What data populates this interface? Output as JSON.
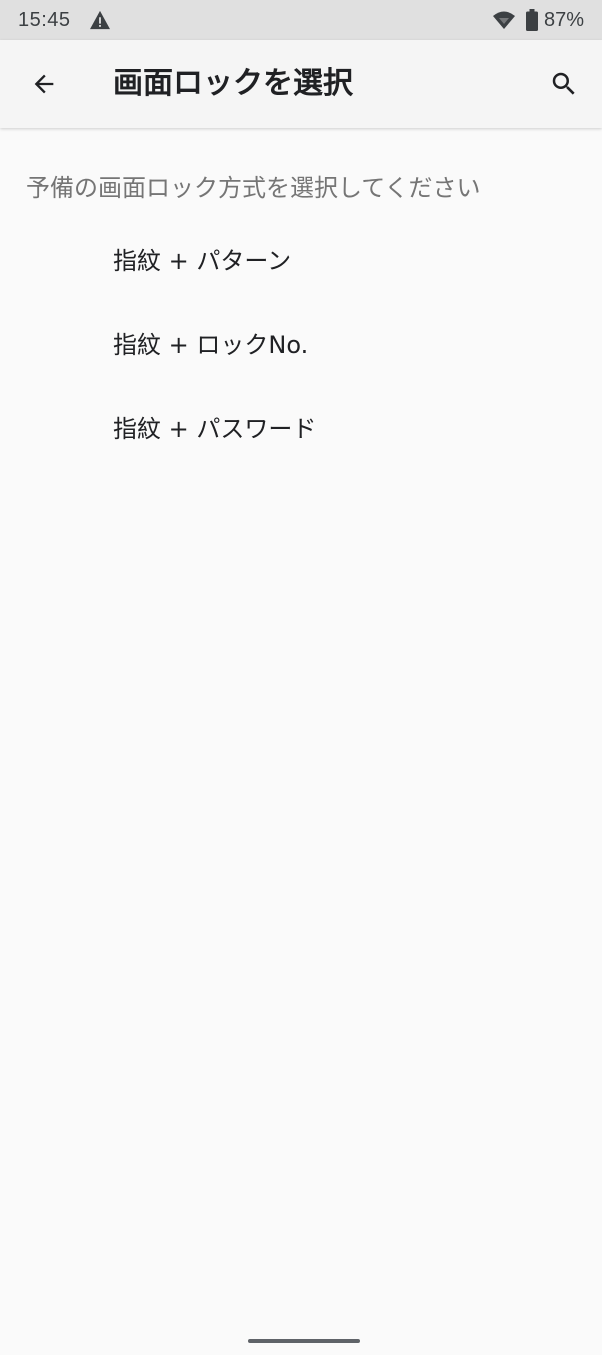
{
  "status_bar": {
    "time": "15:45",
    "battery": "87%",
    "icons": [
      "warning-icon",
      "wifi-icon",
      "battery-icon"
    ]
  },
  "app_bar": {
    "title": "画面ロックを選択",
    "back_icon": "arrow-back-icon",
    "search_icon": "search-icon"
  },
  "section": {
    "header": "予備の画面ロック方式を選択してください"
  },
  "options": [
    {
      "label": "指紋 + パターン"
    },
    {
      "label": "指紋 + ロックNo."
    },
    {
      "label": "指紋 + パスワード"
    }
  ],
  "colors": {
    "status_bar_bg": "#e0e0e0",
    "app_bar_bg": "#f5f5f5",
    "page_bg": "#fafafa",
    "primary_text": "#202124",
    "secondary_text": "#757575"
  }
}
